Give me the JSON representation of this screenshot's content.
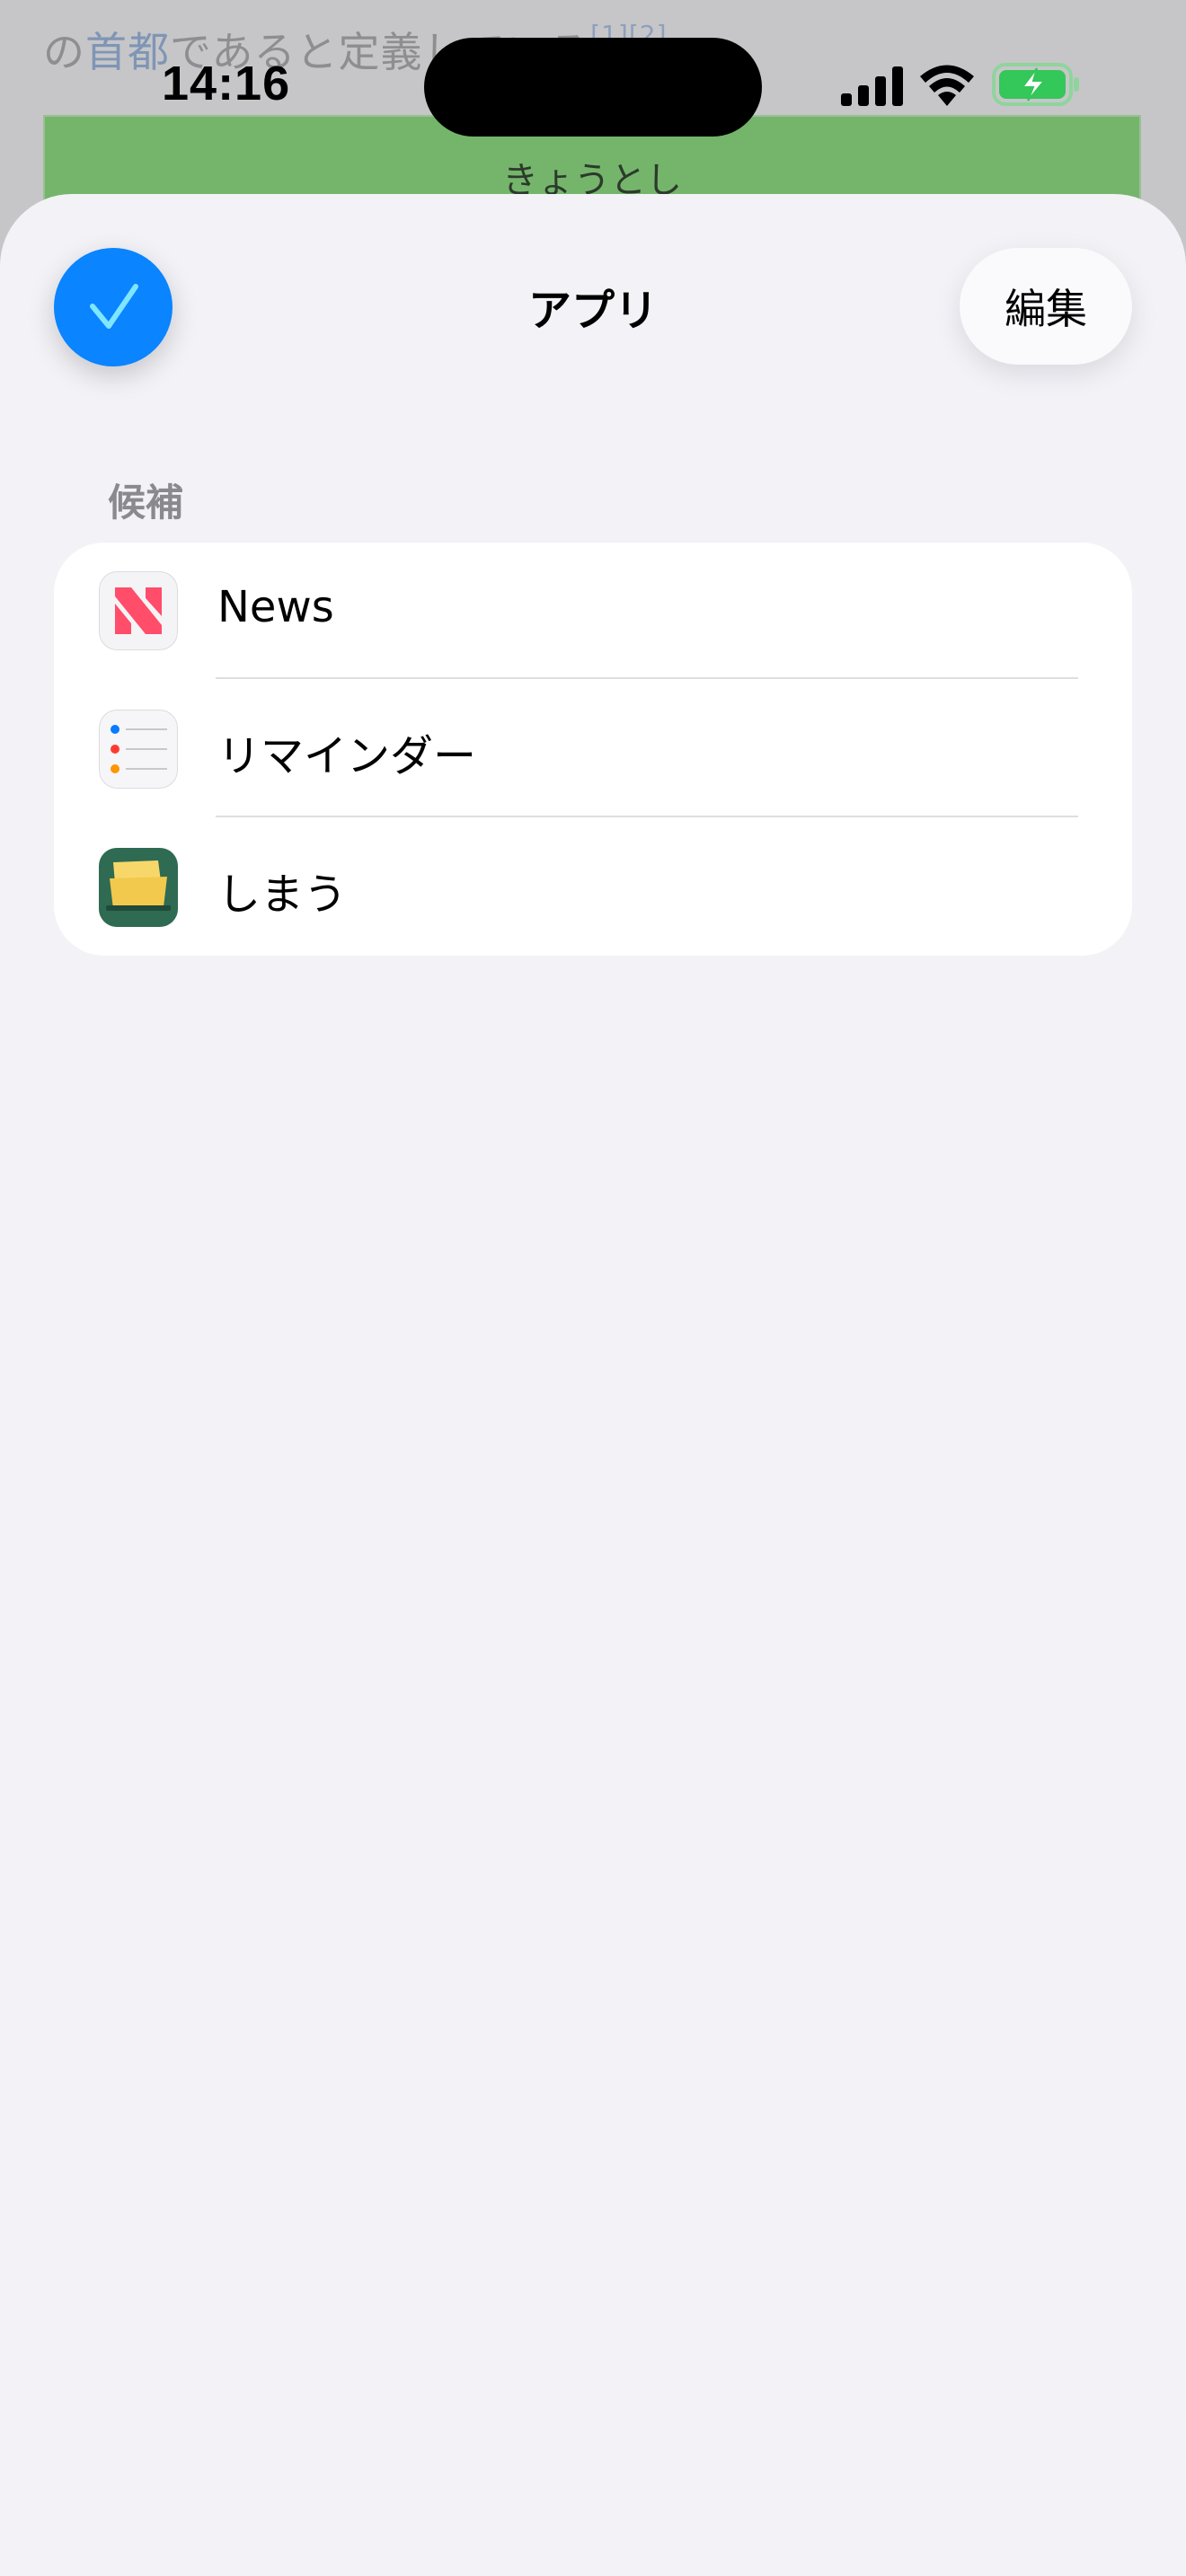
{
  "background": {
    "text_before": "の",
    "text_link": "首都",
    "text_after": "であると定義し",
    "text_tail": "ている",
    "refs": "[1][2]",
    "green_banner": "きょうとし"
  },
  "status_bar": {
    "time": "14:16",
    "battery_color": "#34c759"
  },
  "sheet": {
    "title": "アプリ",
    "edit_label": "編集",
    "accent_color": "#0a84ff",
    "section_header": "候補",
    "items": [
      {
        "label": "News",
        "icon": "news-app-icon"
      },
      {
        "label": "リマインダー",
        "icon": "reminders-app-icon"
      },
      {
        "label": "しまう",
        "icon": "shimau-app-icon"
      }
    ]
  }
}
